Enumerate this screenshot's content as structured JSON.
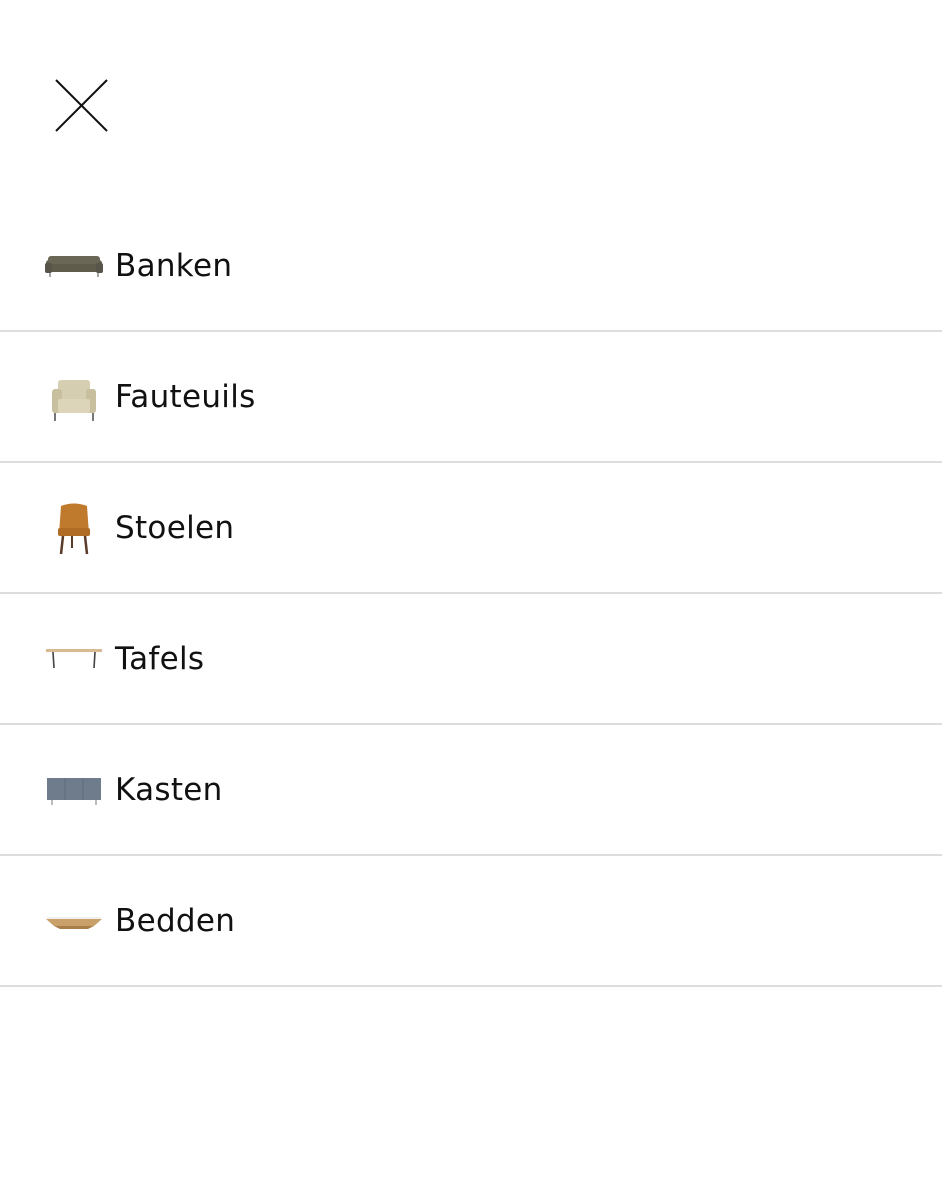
{
  "menu": {
    "items": [
      {
        "label": "Banken",
        "icon": "sofa-icon"
      },
      {
        "label": "Fauteuils",
        "icon": "armchair-icon"
      },
      {
        "label": "Stoelen",
        "icon": "chair-icon"
      },
      {
        "label": "Tafels",
        "icon": "table-icon"
      },
      {
        "label": "Kasten",
        "icon": "cabinet-icon"
      },
      {
        "label": "Bedden",
        "icon": "bed-icon"
      }
    ]
  },
  "colors": {
    "text": "#111111",
    "divider": "#dddddd",
    "sofa": "#5f5c4c",
    "armchair": "#cfc6a8",
    "chair": "#c07a2e",
    "table_top": "#d9b894",
    "cabinet": "#6f7c8c",
    "bed": "#c9a06a"
  }
}
